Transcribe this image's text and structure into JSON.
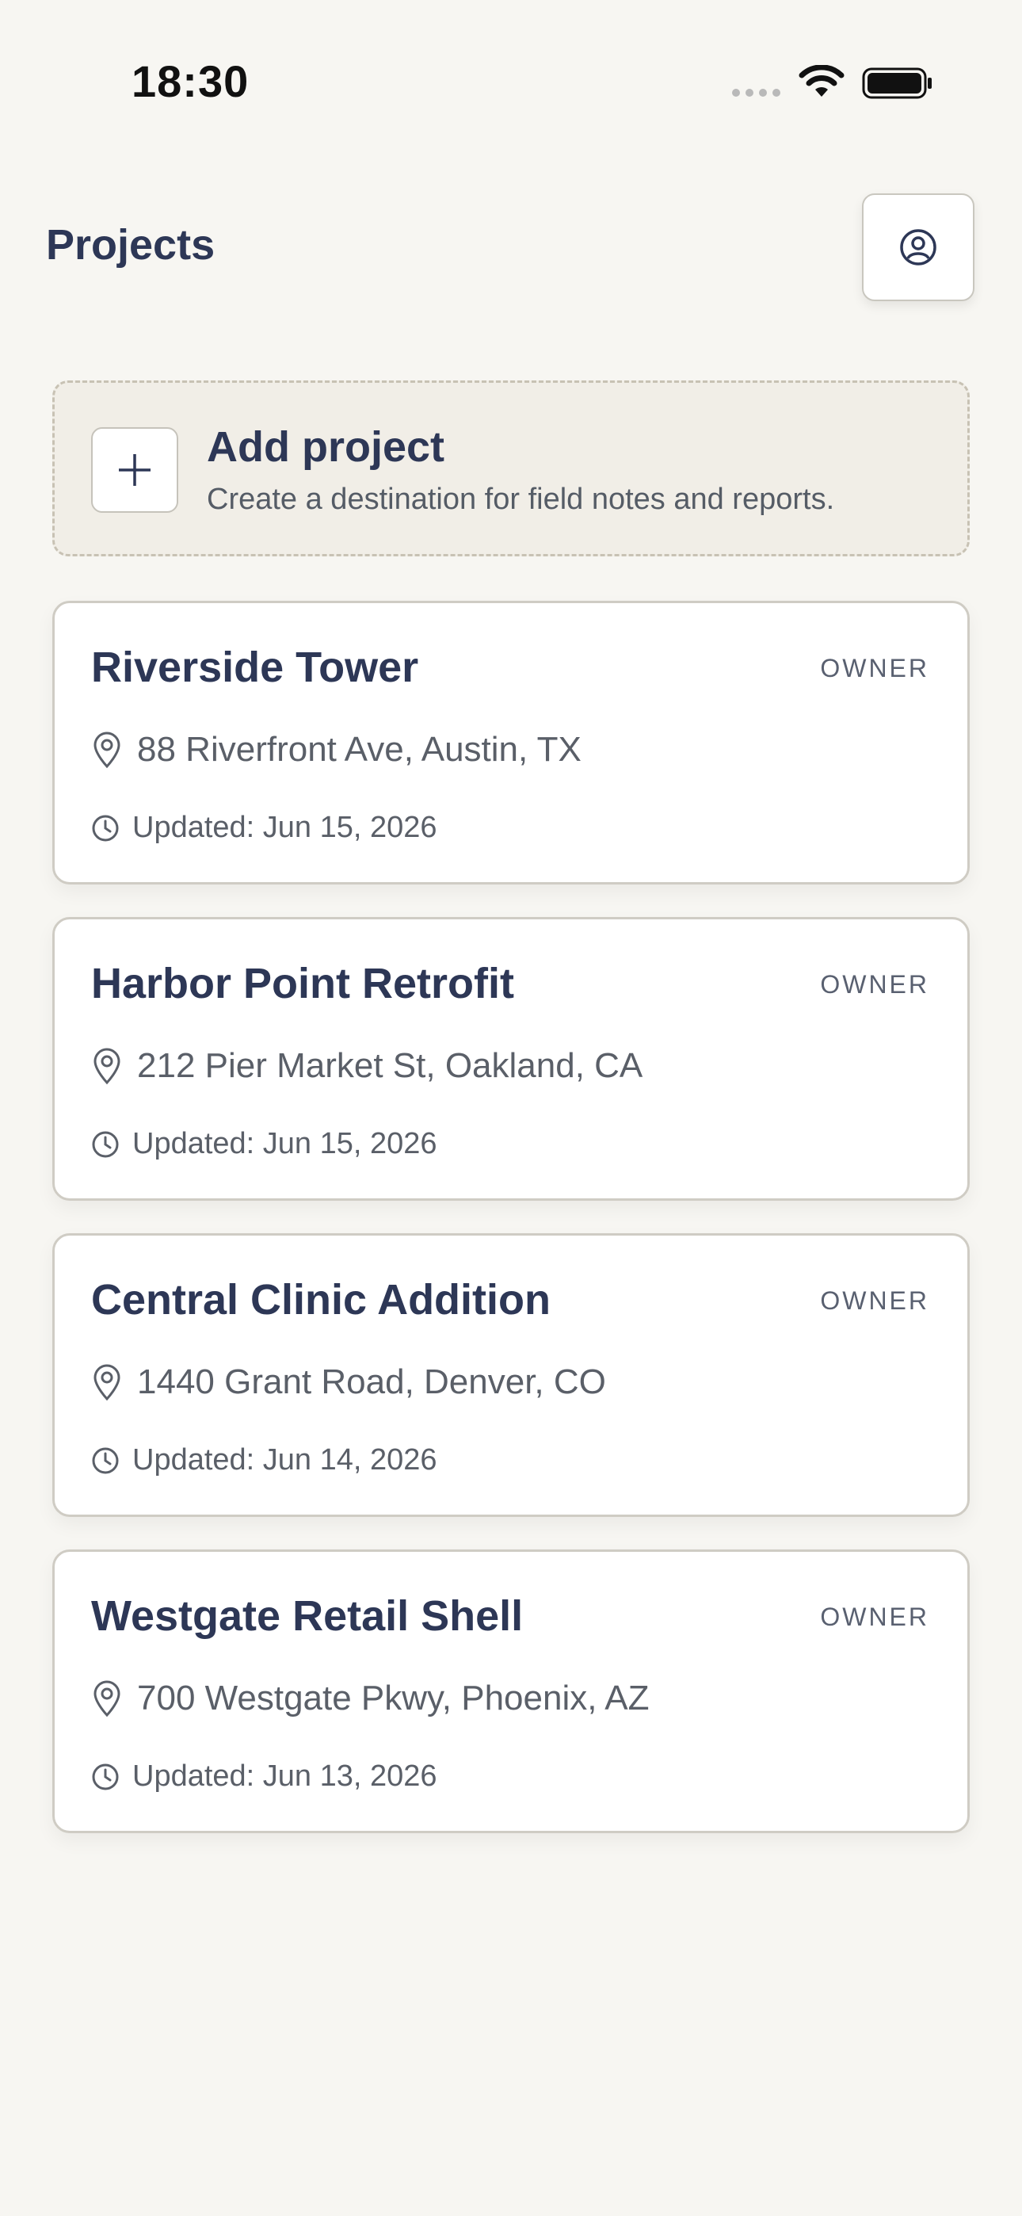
{
  "status_bar": {
    "time": "18:30",
    "icons": [
      "signal-icon",
      "wifi-icon",
      "battery-icon"
    ]
  },
  "header": {
    "title": "Projects",
    "profile_icon": "user-circle-icon"
  },
  "add_project": {
    "title": "Add project",
    "subtitle": "Create a destination for field notes and reports.",
    "icon": "plus-icon"
  },
  "projects": [
    {
      "name": "Riverside Tower",
      "role": "OWNER",
      "address": "88 Riverfront Ave, Austin, TX",
      "updated": "Updated: Jun 15, 2026"
    },
    {
      "name": "Harbor Point Retrofit",
      "role": "OWNER",
      "address": "212 Pier Market St, Oakland, CA",
      "updated": "Updated: Jun 15, 2026"
    },
    {
      "name": "Central Clinic Addition",
      "role": "OWNER",
      "address": "1440 Grant Road, Denver, CO",
      "updated": "Updated: Jun 14, 2026"
    },
    {
      "name": "Westgate Retail Shell",
      "role": "OWNER",
      "address": "700 Westgate Pkwy, Phoenix, AZ",
      "updated": "Updated: Jun 13, 2026"
    }
  ],
  "colors": {
    "background": "#f7f6f2",
    "text_primary": "#2d3756",
    "text_secondary": "#5a5f68",
    "card_border": "#cfccc4",
    "add_background": "#f1eee7"
  }
}
